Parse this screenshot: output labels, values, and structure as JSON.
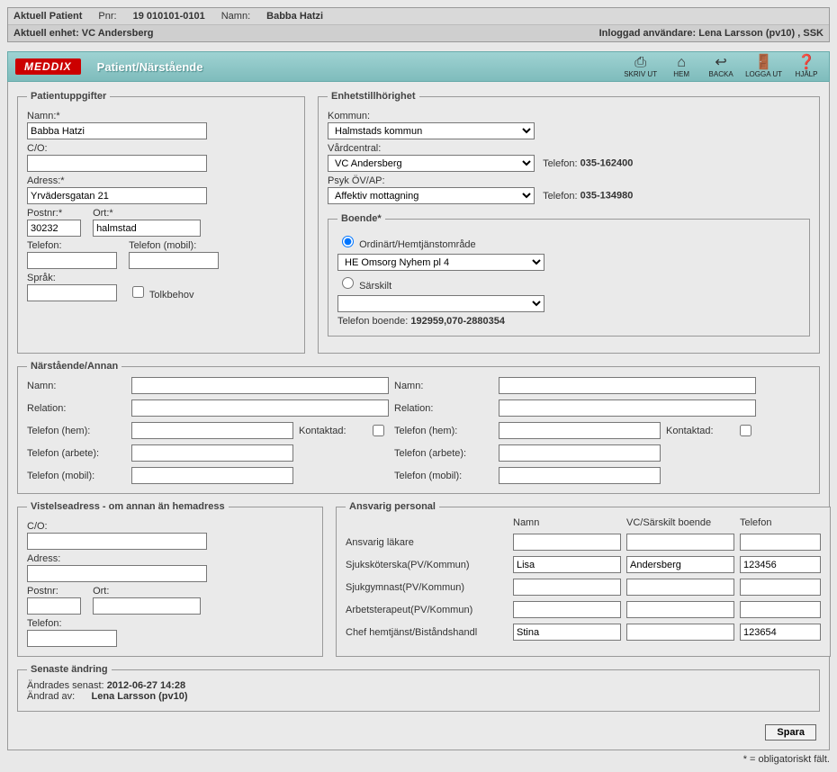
{
  "topbar": {
    "aktuell_patient_label": "Aktuell Patient",
    "pnr_label": "Pnr:",
    "pnr_value": "19 010101-0101",
    "namn_label": "Namn:",
    "namn_value": "Babba Hatzi",
    "aktuell_enhet_label": "Aktuell enhet: VC Andersberg",
    "inloggad_label": "Inloggad användare: Lena Larsson (pv10) , SSK"
  },
  "toolbar": {
    "brand": "MEDDIX",
    "breadcrumb": "Patient/Närstående",
    "icons": {
      "skriv_ut": "SKRIV UT",
      "hem": "HEM",
      "backa": "BACKA",
      "logga_ut": "LOGGA UT",
      "hjalp": "HJÄLP"
    }
  },
  "patient": {
    "legend": "Patientuppgifter",
    "namn_label": "Namn:*",
    "namn": "Babba Hatzi",
    "co_label": "C/O:",
    "co": "",
    "adress_label": "Adress:*",
    "adress": "Yrvädersgatan 21",
    "postnr_label": "Postnr:*",
    "postnr": "30232",
    "ort_label": "Ort:*",
    "ort": "halmstad",
    "telefon_label": "Telefon:",
    "telefon": "",
    "telefon_mobil_label": "Telefon (mobil):",
    "telefon_mobil": "",
    "sprak_label": "Språk:",
    "sprak": "",
    "tolkbehov_label": "Tolkbehov"
  },
  "enhet": {
    "legend": "Enhetstillhörighet",
    "kommun_label": "Kommun:",
    "kommun": "Halmstads kommun",
    "vardcentral_label": "Vårdcentral:",
    "vardcentral": "VC Andersberg",
    "vardcentral_tel_label": "Telefon:",
    "vardcentral_tel": "035-162400",
    "psyk_label": "Psyk ÖV/AP:",
    "psyk": "Affektiv mottagning",
    "psyk_tel_label": "Telefon:",
    "psyk_tel": "035-134980"
  },
  "boende": {
    "legend": "Boende*",
    "ordinart_label": "Ordinärt/Hemtjänstområde",
    "ordinart_select": "HE Omsorg Nyhem pl 4",
    "sarskilt_label": "Särskilt",
    "sarskilt_select": "",
    "telefon_boende_label": "Telefon boende:",
    "telefon_boende": "192959,070-2880354"
  },
  "kin": {
    "legend": "Närstående/Annan",
    "namn_label": "Namn:",
    "relation_label": "Relation:",
    "tel_hem_label": "Telefon (hem):",
    "tel_arbete_label": "Telefon (arbete):",
    "tel_mobil_label": "Telefon (mobil):",
    "kontaktad_label": "Kontaktad:",
    "left": {
      "namn": "",
      "relation": "",
      "tel_hem": "",
      "tel_arbete": "",
      "tel_mobil": ""
    },
    "right": {
      "namn": "",
      "relation": "",
      "tel_hem": "",
      "tel_arbete": "",
      "tel_mobil": ""
    }
  },
  "vistelse": {
    "legend": "Vistelseadress - om annan än hemadress",
    "co_label": "C/O:",
    "co": "",
    "adress_label": "Adress:",
    "adress": "",
    "postnr_label": "Postnr:",
    "postnr": "",
    "ort_label": "Ort:",
    "ort": "",
    "telefon_label": "Telefon:",
    "telefon": ""
  },
  "ansvarig": {
    "legend": "Ansvarig personal",
    "col_namn": "Namn",
    "col_vc": "VC/Särskilt boende",
    "col_tel": "Telefon",
    "rows": [
      {
        "role": "Ansvarig läkare",
        "namn": "",
        "vc": "",
        "tel": ""
      },
      {
        "role": "Sjuksköterska(PV/Kommun)",
        "namn": "Lisa",
        "vc": "Andersberg",
        "tel": "123456"
      },
      {
        "role": "Sjukgymnast(PV/Kommun)",
        "namn": "",
        "vc": "",
        "tel": ""
      },
      {
        "role": "Arbetsterapeut(PV/Kommun)",
        "namn": "",
        "vc": "",
        "tel": ""
      },
      {
        "role": "Chef hemtjänst/Biståndshandl",
        "namn": "Stina",
        "vc": "",
        "tel": "123654"
      }
    ]
  },
  "senaste": {
    "legend": "Senaste ändring",
    "andrades_label": "Ändrades senast:",
    "andrades": "2012-06-27 14:28",
    "andrad_av_label": "Ändrad av:",
    "andrad_av": "Lena Larsson (pv10)"
  },
  "footer": {
    "spara": "Spara",
    "oblig": "* = obligatoriskt fält."
  }
}
